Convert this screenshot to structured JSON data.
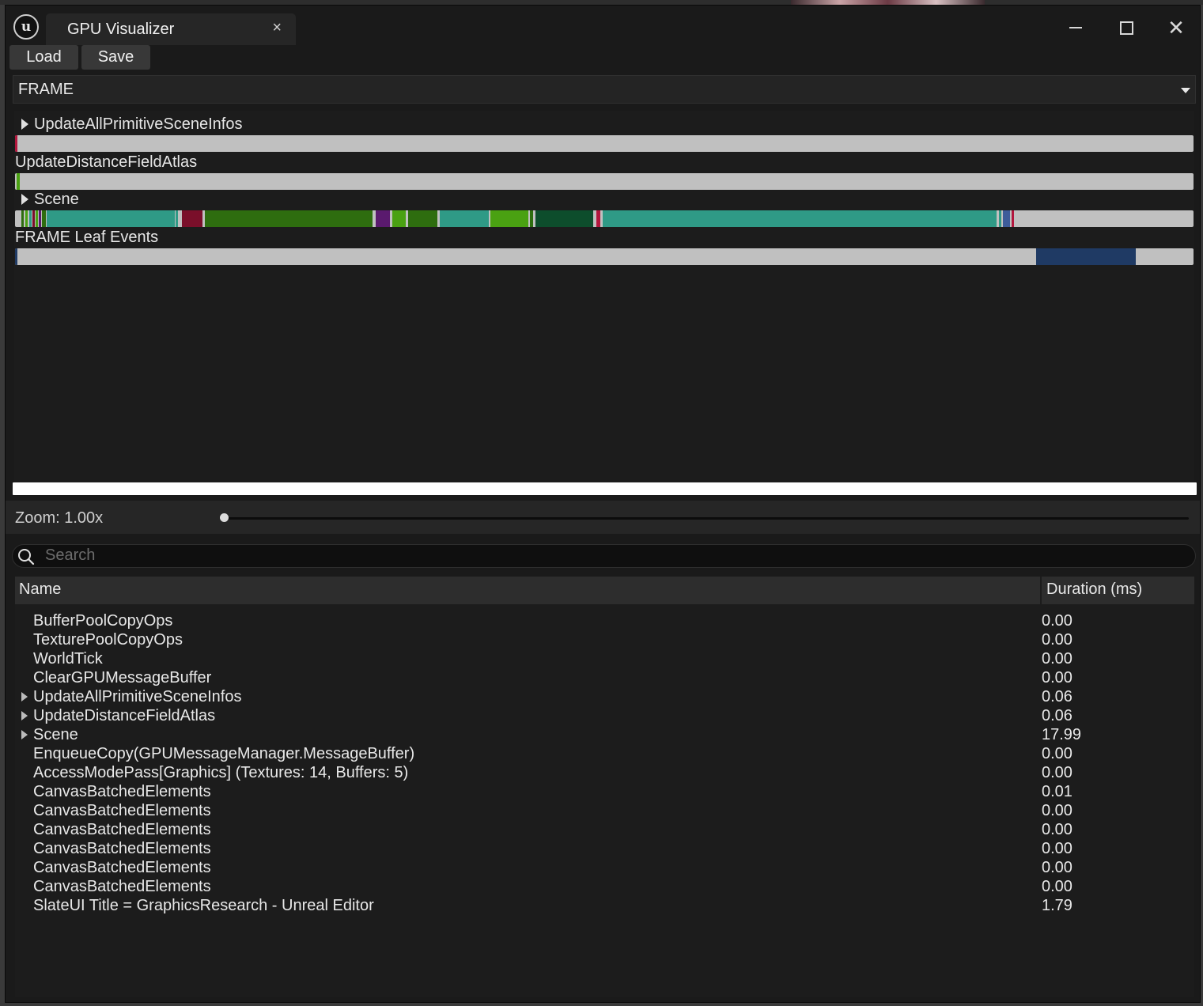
{
  "window": {
    "tab_title": "GPU Visualizer",
    "tab_close": "×",
    "logo_text": "u",
    "close_glyph": "✕"
  },
  "toolbar": {
    "load_label": "Load",
    "save_label": "Save"
  },
  "frame_select": {
    "value": "FRAME"
  },
  "timeline": {
    "rows": [
      {
        "label": "UpdateAllPrimitiveSceneInfos",
        "expandable": true
      },
      {
        "label": "UpdateDistanceFieldAtlas",
        "expandable": false
      },
      {
        "label": "Scene",
        "expandable": true
      },
      {
        "label": "FRAME Leaf Events",
        "expandable": false
      }
    ]
  },
  "zoom": {
    "label": "Zoom: 1.00x",
    "value": 1.0
  },
  "search": {
    "placeholder": "Search"
  },
  "table": {
    "headers": {
      "name": "Name",
      "duration": "Duration (ms)"
    },
    "rows": [
      {
        "name": "BufferPoolCopyOps",
        "duration": "0.00",
        "expandable": false
      },
      {
        "name": "TexturePoolCopyOps",
        "duration": "0.00",
        "expandable": false
      },
      {
        "name": "WorldTick",
        "duration": "0.00",
        "expandable": false
      },
      {
        "name": "ClearGPUMessageBuffer",
        "duration": "0.00",
        "expandable": false
      },
      {
        "name": "UpdateAllPrimitiveSceneInfos",
        "duration": "0.06",
        "expandable": true
      },
      {
        "name": "UpdateDistanceFieldAtlas",
        "duration": "0.06",
        "expandable": true
      },
      {
        "name": "Scene",
        "duration": "17.99",
        "expandable": true
      },
      {
        "name": "EnqueueCopy(GPUMessageManager.MessageBuffer)",
        "duration": "0.00",
        "expandable": false
      },
      {
        "name": "AccessModePass[Graphics] (Textures: 14, Buffers: 5)",
        "duration": "0.00",
        "expandable": false
      },
      {
        "name": "CanvasBatchedElements",
        "duration": "0.01",
        "expandable": false
      },
      {
        "name": "CanvasBatchedElements",
        "duration": "0.00",
        "expandable": false
      },
      {
        "name": "CanvasBatchedElements",
        "duration": "0.00",
        "expandable": false
      },
      {
        "name": "CanvasBatchedElements",
        "duration": "0.00",
        "expandable": false
      },
      {
        "name": "CanvasBatchedElements",
        "duration": "0.00",
        "expandable": false
      },
      {
        "name": "CanvasBatchedElements",
        "duration": "0.00",
        "expandable": false
      },
      {
        "name": "SlateUI Title = GraphicsResearch - Unreal Editor",
        "duration": "1.79",
        "expandable": false
      }
    ]
  },
  "colors": {
    "background": "#1a1a1a",
    "track": "#c0c0c0",
    "teal": "#2f9a86",
    "dark_green": "#2e6d0f",
    "bright_green": "#4aa112",
    "forest_green": "#0d4d2c",
    "maroon": "#7a0f2a",
    "purple": "#5a1a6e",
    "navy": "#1f3a64"
  }
}
